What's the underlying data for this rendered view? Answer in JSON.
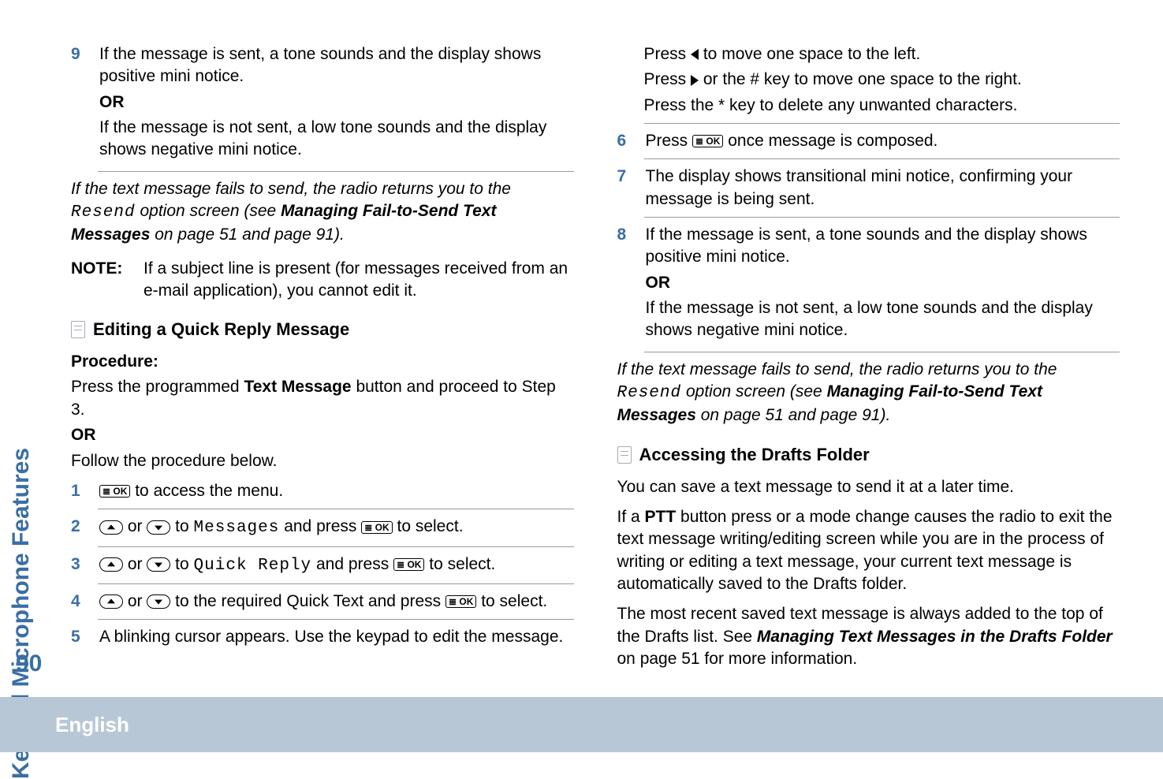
{
  "sideTab": "Keypad Microphone Features",
  "pageNumber": "90",
  "footer": "English",
  "left": {
    "step9": {
      "num": "9",
      "l1": "If the message is sent, a tone sounds and the display shows positive mini notice.",
      "or": "OR",
      "l2": "If the message is not sent, a low tone sounds and the display shows negative mini notice."
    },
    "failNote": {
      "part1": "If the text message fails to send, the radio returns you to the ",
      "resend": "Resend",
      "part2": " option screen (see ",
      "bold": "Managing Fail-to-Send Text Messages",
      "part3": " on page 51 and page 91)."
    },
    "note": {
      "label": "NOTE:",
      "text": "If a subject line is present (for messages received from an e-mail application), you cannot edit it."
    },
    "heading1": "Editing a Quick Reply Message",
    "procLabel": "Procedure:",
    "procLine1a": "Press the programmed ",
    "procLine1b": "Text Message",
    "procLine1c": " button and proceed to Step 3.",
    "procOr": "OR",
    "procLine2": "Follow the procedure below.",
    "s1": {
      "num": "1",
      "text": " to access the menu."
    },
    "s2": {
      "num": "2",
      "pre": " or ",
      "mid": " to ",
      "menu": "Messages",
      "post": " and press ",
      "end": " to select."
    },
    "s3": {
      "num": "3",
      "pre": " or ",
      "mid": " to ",
      "menu": "Quick Reply",
      "post": " and press ",
      "end": " to select."
    },
    "s4": {
      "num": "4",
      "pre": " or ",
      "mid": " to the required Quick Text and press ",
      "end": " to select."
    },
    "s5": {
      "num": "5",
      "text": "A blinking cursor appears. Use the keypad to edit the message."
    }
  },
  "right": {
    "r5a": "Press ",
    "r5b": " to move one space to the left.",
    "r5c": "Press ",
    "r5d": " or the # key to move one space to the right.",
    "r5e": "Press the * key to delete any unwanted characters.",
    "s6": {
      "num": "6",
      "pre": "Press ",
      "post": " once message is composed."
    },
    "s7": {
      "num": "7",
      "text": "The display shows transitional mini notice, confirming your message is being sent."
    },
    "s8": {
      "num": "8",
      "l1": "If the message is sent, a tone sounds and the display shows positive mini notice.",
      "or": "OR",
      "l2": "If the message is not sent, a low tone sounds and the display shows negative mini notice."
    },
    "failNote": {
      "part1": "If the text message fails to send, the radio returns you to the ",
      "resend": "Resend",
      "part2": " option screen (see ",
      "bold": "Managing Fail-to-Send Text Messages",
      "part3": " on page 51 and page 91)."
    },
    "heading2": "Accessing the Drafts Folder",
    "p1": "You can save a text message to send it at a later time.",
    "p2a": "If a ",
    "p2ptt": "PTT",
    "p2b": " button press or a mode change causes the radio to exit the text message writing/editing screen while you are in the process of writing or editing a text message, your current text message is automatically saved to the Drafts folder.",
    "p3a": "The most recent saved text message is always added to the top of the Drafts list. See ",
    "p3bold": "Managing Text Messages in the Drafts Folder",
    "p3b": " on page 51 for more information."
  },
  "okLabel": "≣ OK"
}
